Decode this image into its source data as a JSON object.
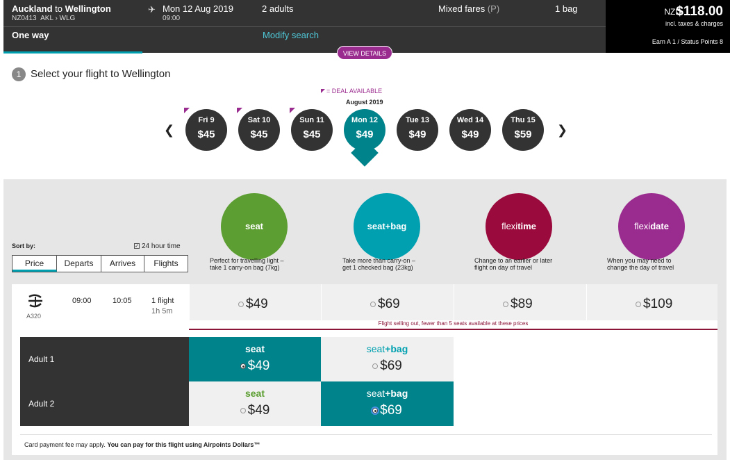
{
  "header": {
    "origin": "Auckland",
    "to_word": " to ",
    "destination": "Wellington",
    "flight_number": "NZ0413",
    "route_codes": "AKL › WLG",
    "date": "Mon 12 Aug 2019",
    "time": "09:00",
    "passengers": "2 adults",
    "fares_label": "Mixed fares",
    "fares_tag": "(P)",
    "bags": "1 bag",
    "trip_type": "One way",
    "modify_link": "Modify search",
    "view_details": "VIEW DETAILS"
  },
  "price_summary": {
    "currency": "NZD",
    "total": "$118.00",
    "incl": "incl. taxes & charges",
    "earn": "Earn A 1 / Status Points 8"
  },
  "step": {
    "number": "1",
    "title": "Select your flight to Wellington"
  },
  "calendar": {
    "deal_note": "= DEAL AVAILABLE",
    "month": "August 2019",
    "prev_icon": "chevron-left-icon",
    "next_icon": "chevron-right-icon",
    "days": [
      {
        "label": "Fri 9",
        "price": "$45",
        "deal": true
      },
      {
        "label": "Sat 10",
        "price": "$45",
        "deal": true
      },
      {
        "label": "Sun 11",
        "price": "$45",
        "deal": true
      },
      {
        "label": "Mon 12",
        "price": "$49",
        "deal": false,
        "selected": true
      },
      {
        "label": "Tue 13",
        "price": "$49",
        "deal": false
      },
      {
        "label": "Wed 14",
        "price": "$49",
        "deal": false
      },
      {
        "label": "Thu 15",
        "price": "$59",
        "deal": false
      }
    ]
  },
  "fares": [
    {
      "name_a": "seat",
      "name_b": "",
      "color": "#5c9e31",
      "desc1": "Perfect for travelling light –",
      "desc2": "take 1 carry-on bag (7kg)"
    },
    {
      "name_a": "seat",
      "name_b": "+bag",
      "color": "#00a0b0",
      "desc1": "Take more than carry-on –",
      "desc2": "get 1 checked bag (23kg)"
    },
    {
      "name_a": "flexi",
      "name_b": "time",
      "color": "#9b0a3c",
      "desc1": "Change to an earlier or later",
      "desc2": "flight on day of travel"
    },
    {
      "name_a": "flexi",
      "name_b": "date",
      "color": "#9b2c8f",
      "desc1": "When you may need to",
      "desc2": "change the day of travel"
    }
  ],
  "sort": {
    "label": "Sort by:",
    "hour24_label": "24 hour time",
    "tabs": [
      "Price",
      "Departs",
      "Arrives",
      "Flights"
    ]
  },
  "flight": {
    "aircraft": "A320",
    "depart": "09:00",
    "arrive": "10:05",
    "num_flights": "1 flight",
    "duration": "1h 5m",
    "prices": [
      "$49",
      "$69",
      "$89",
      "$109"
    ],
    "sellout_msg": "Flight selling out, fewer than 5 seats available at these prices"
  },
  "passengers": [
    {
      "label": "Adult 1",
      "seat_price": "$49",
      "seatbag_price": "$69",
      "selected": "seat"
    },
    {
      "label": "Adult 2",
      "seat_price": "$49",
      "seatbag_price": "$69",
      "selected": "seat+bag"
    }
  ],
  "fare_labels": {
    "seat": "seat",
    "seatbag_a": "seat",
    "seatbag_b": "+bag"
  },
  "footer": {
    "note": "Card payment fee may apply. ",
    "note_bold": "You can pay for this flight using Airpoints Dollars™"
  }
}
